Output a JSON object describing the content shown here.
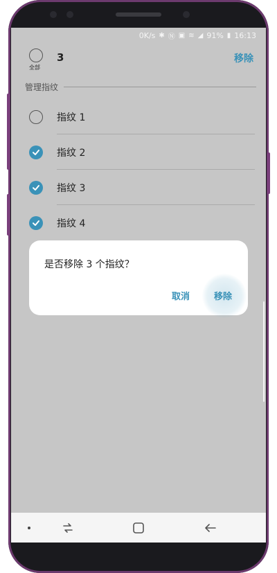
{
  "status_bar": {
    "speed": "0K/s",
    "battery": "91%",
    "time": "16:13"
  },
  "header": {
    "select_all_label": "全部",
    "selected_count": "3",
    "remove_label": "移除"
  },
  "section": {
    "title": "管理指纹"
  },
  "fingerprints": [
    {
      "label": "指纹 1",
      "checked": false
    },
    {
      "label": "指纹 2",
      "checked": true
    },
    {
      "label": "指纹 3",
      "checked": true
    },
    {
      "label": "指纹 4",
      "checked": true
    }
  ],
  "dialog": {
    "message": "是否移除 3 个指纹？",
    "cancel_label": "取消",
    "confirm_label": "移除"
  },
  "colors": {
    "accent": "#3a92b8",
    "overlay": "#c6c6c6",
    "phone_frame": "#6c3a6e"
  },
  "navbar": {
    "icons": [
      "recent-apps-icon",
      "home-icon",
      "back-icon"
    ]
  }
}
